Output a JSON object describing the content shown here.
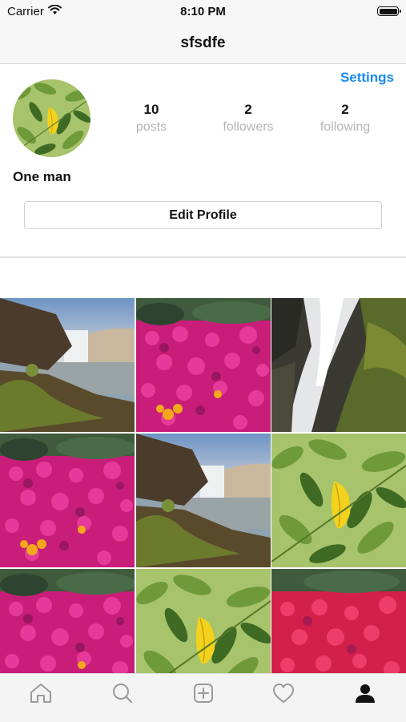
{
  "status_bar": {
    "carrier": "Carrier",
    "time": "8:10 PM"
  },
  "nav": {
    "title": "sfsdfe"
  },
  "profile": {
    "settings_label": "Settings",
    "stats": [
      {
        "value": "10",
        "label": "posts"
      },
      {
        "value": "2",
        "label": "followers"
      },
      {
        "value": "2",
        "label": "following"
      }
    ],
    "display_name": "One man",
    "edit_button_label": "Edit Profile"
  },
  "grid": {
    "posts": [
      {
        "image": "waterfall-coast"
      },
      {
        "image": "magenta-flowers"
      },
      {
        "image": "waterfall-closeup"
      },
      {
        "image": "magenta-flowers"
      },
      {
        "image": "waterfall-coast"
      },
      {
        "image": "leaves-yellow"
      },
      {
        "image": "magenta-flowers"
      },
      {
        "image": "leaves-yellow"
      },
      {
        "image": "red-flowers"
      }
    ]
  },
  "tab_bar": {
    "items": [
      {
        "icon": "home-icon"
      },
      {
        "icon": "search-icon"
      },
      {
        "icon": "add-post-icon"
      },
      {
        "icon": "heart-icon"
      },
      {
        "icon": "profile-icon",
        "active": true
      }
    ]
  },
  "colors": {
    "link": "#1a8cf0",
    "muted_label": "#b5b5b5",
    "active_tab": "#111111",
    "inactive_tab": "#9a9a9a"
  }
}
